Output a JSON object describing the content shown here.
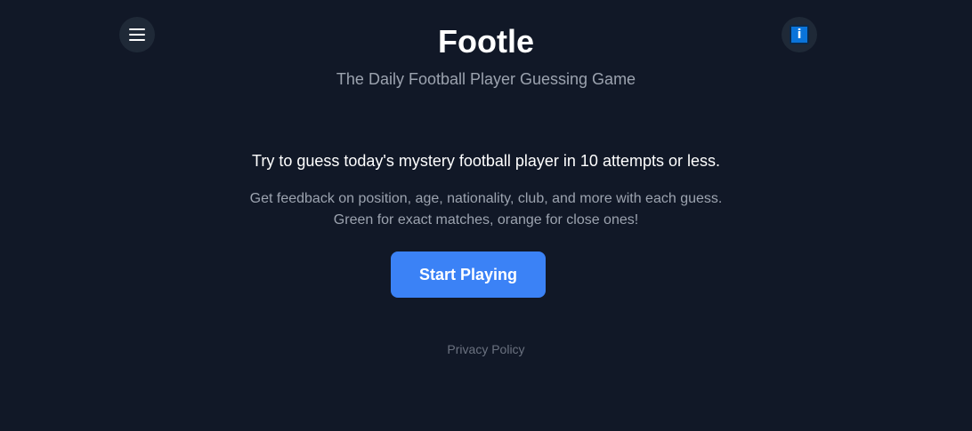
{
  "header": {
    "title": "Footle",
    "subtitle": "The Daily Football Player Guessing Game",
    "menu_icon": "hamburger-menu-icon",
    "info_icon": "info-icon",
    "info_glyph": "i"
  },
  "main": {
    "headline": "Try to guess today's mystery football player in 10 attempts or less.",
    "description_line1": "Get feedback on position, age, nationality, club, and more with each guess.",
    "description_line2": "Green for exact matches, orange for close ones!",
    "start_button_label": "Start Playing"
  },
  "footer": {
    "privacy_link": "Privacy Policy"
  },
  "colors": {
    "background": "#111827",
    "accent": "#3b82f6",
    "muted_text": "#9ca3af",
    "link_text": "#6b7280"
  }
}
